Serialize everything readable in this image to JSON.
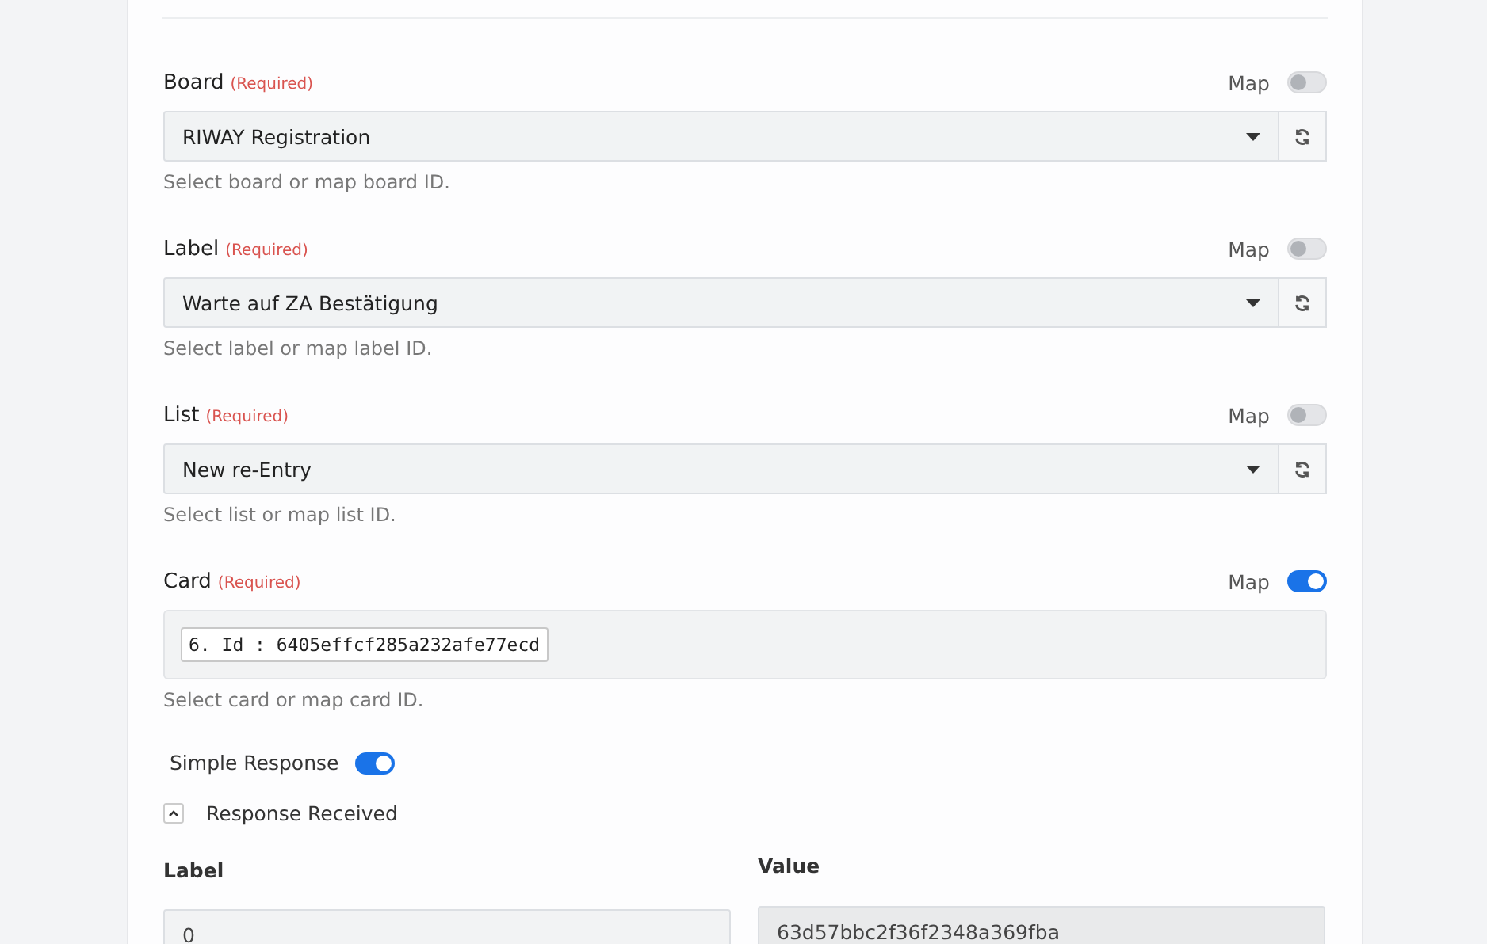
{
  "fields": [
    {
      "kind": "select",
      "label": "Board",
      "required": "(Required)",
      "map_label": "Map",
      "map_on": false,
      "value": "RIWAY Registration",
      "hint": "Select board or map board ID."
    },
    {
      "kind": "select",
      "label": "Label",
      "required": "(Required)",
      "map_label": "Map",
      "map_on": false,
      "value": "Warte auf ZA Bestätigung",
      "hint": "Select label or map label ID."
    },
    {
      "kind": "select",
      "label": "List",
      "required": "(Required)",
      "map_label": "Map",
      "map_on": false,
      "value": "New re-Entry",
      "hint": "Select list or map list ID."
    },
    {
      "kind": "mapped",
      "label": "Card",
      "required": "(Required)",
      "map_label": "Map",
      "map_on": true,
      "value": "6. Id : 6405effcf285a232afe77ecd",
      "hint": "Select card or map card ID."
    }
  ],
  "simple_response": {
    "label": "Simple Response",
    "on": true
  },
  "response": {
    "title": "Response Received",
    "expanded": true,
    "label_heading": "Label",
    "value_heading": "Value",
    "label_value": "0",
    "value_value": "63d57bbc2f36f2348a369fba"
  }
}
